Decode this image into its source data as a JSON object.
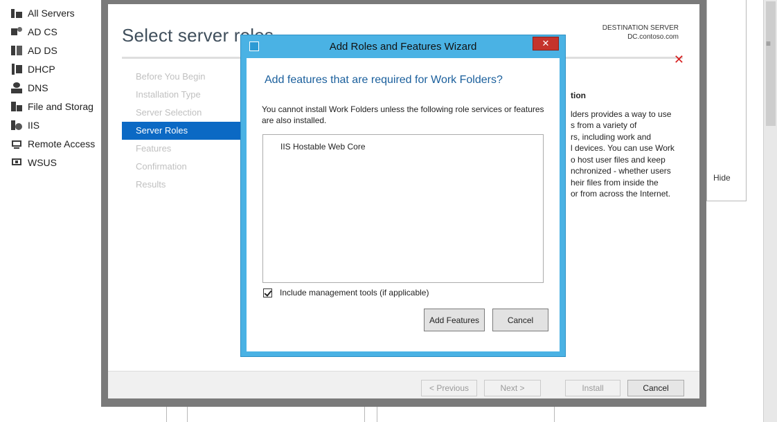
{
  "server_manager": {
    "nav_items": [
      {
        "label": "All Servers",
        "icon": "servers-icon"
      },
      {
        "label": "AD CS",
        "icon": "certificate-icon"
      },
      {
        "label": "AD DS",
        "icon": "directory-icon"
      },
      {
        "label": "DHCP",
        "icon": "dhcp-icon"
      },
      {
        "label": "DNS",
        "icon": "dns-icon"
      },
      {
        "label": "File and Storag",
        "icon": "file-storage-icon"
      },
      {
        "label": "IIS",
        "icon": "iis-icon"
      },
      {
        "label": "Remote Access",
        "icon": "remote-access-icon"
      },
      {
        "label": "WSUS",
        "icon": "wsus-icon"
      }
    ],
    "hide_label": "Hide",
    "menu_glyph": "≡"
  },
  "wizard": {
    "title": "Select server roles",
    "destination_label": "DESTINATION SERVER",
    "destination_server": "DC.contoso.com",
    "close_glyph": "✕",
    "steps": [
      {
        "label": "Before You Begin",
        "active": false
      },
      {
        "label": "Installation Type",
        "active": false
      },
      {
        "label": "Server Selection",
        "active": false
      },
      {
        "label": "Server Roles",
        "active": true
      },
      {
        "label": "Features",
        "active": false
      },
      {
        "label": "Confirmation",
        "active": false
      },
      {
        "label": "Results",
        "active": false
      }
    ],
    "description_heading": "tion",
    "description_lines": [
      "lders provides a way to use",
      "s from a variety of",
      "rs, including work and",
      "l devices. You can use Work",
      "o host user files and keep",
      "nchronized - whether users",
      "heir files from inside the",
      " or from across the Internet."
    ],
    "buttons": {
      "previous": "< Previous",
      "next": "Next >",
      "install": "Install",
      "cancel": "Cancel"
    }
  },
  "dialog": {
    "title": "Add Roles and Features Wizard",
    "close_glyph": "✕",
    "heading": "Add features that are required for Work Folders?",
    "message": "You cannot install Work Folders unless the following role services or features are also installed.",
    "features": [
      "IIS Hostable Web Core"
    ],
    "include_tools_label": "Include management tools (if applicable)",
    "include_tools_checked": true,
    "buttons": {
      "add_features": "Add Features",
      "cancel": "Cancel"
    }
  },
  "colors": {
    "accent": "#0b69c4",
    "dialog_frame": "#4ab2e4",
    "close_button": "#c5332c",
    "heading": "#1a5f9c"
  }
}
